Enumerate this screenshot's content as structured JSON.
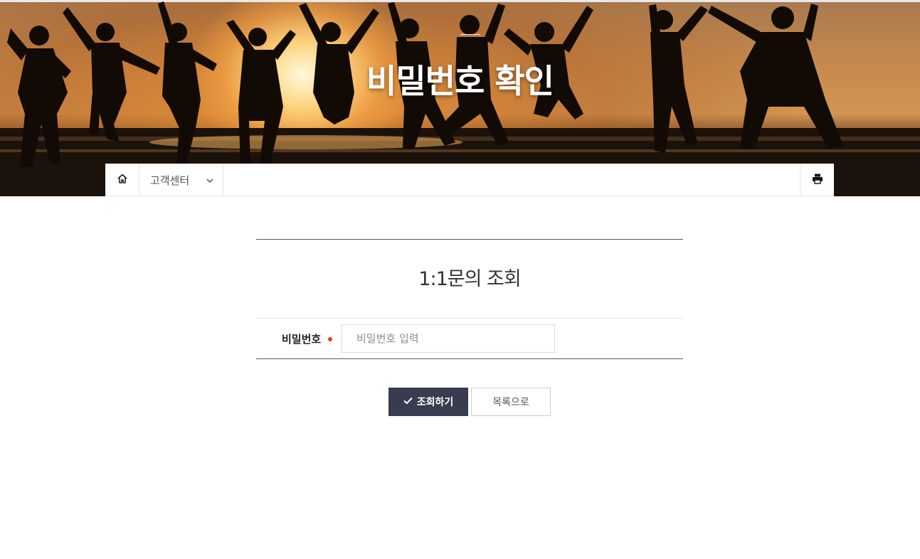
{
  "hero": {
    "title": "비밀번호 확인"
  },
  "breadcrumb": {
    "home_icon": "home-icon",
    "section_label": "고객센터",
    "dropdown_icon": "chevron-down-icon",
    "print_icon": "print-icon"
  },
  "form": {
    "title": "1:1문의 조회",
    "password_label": "비밀번호",
    "password_placeholder": "비밀번호 입력",
    "required_color": "#e0441c"
  },
  "buttons": {
    "submit_label": "조회하기",
    "submit_icon": "check-icon",
    "list_label": "목록으로"
  },
  "colors": {
    "primary_button": "#373d4f",
    "divider_dark": "#555a66"
  }
}
